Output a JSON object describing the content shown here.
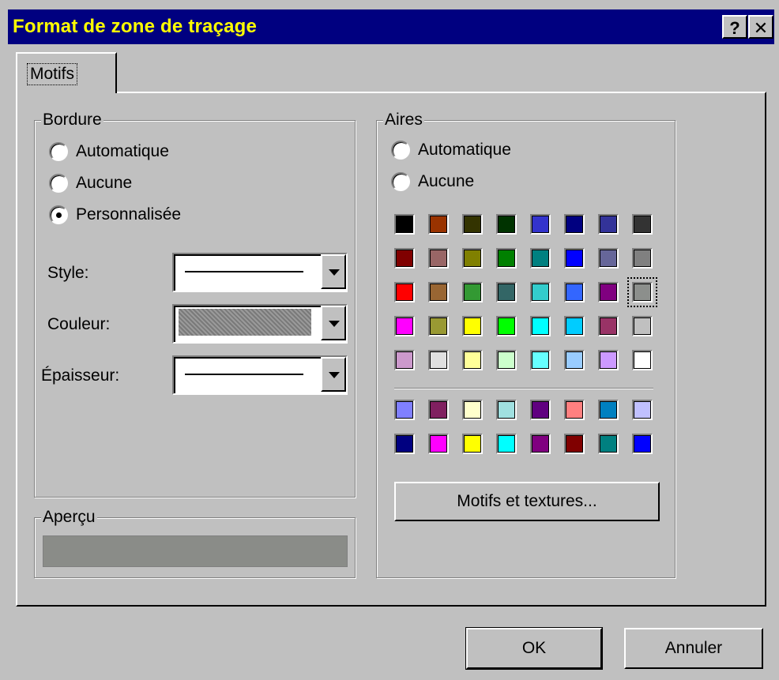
{
  "window": {
    "title": "Format de zone de traçage",
    "help_label": "?",
    "close_label": "✕"
  },
  "tabs": [
    {
      "label": "Motifs",
      "active": true
    }
  ],
  "border_group": {
    "label": "Bordure",
    "options": [
      {
        "label": "Automatique",
        "selected": false
      },
      {
        "label": "Aucune",
        "selected": false
      },
      {
        "label": "Personnalisée",
        "selected": true
      }
    ],
    "style_label": "Style:",
    "color_label": "Couleur:",
    "thickness_label": "Épaisseur:",
    "style_value": "solid-line",
    "color_value": "#8a8a8a",
    "thickness_value": "thin-line"
  },
  "preview_group": {
    "label": "Aperçu",
    "fill_color": "#8a8c88"
  },
  "area_group": {
    "label": "Aires",
    "options": [
      {
        "label": "Automatique",
        "selected": false
      },
      {
        "label": "Aucune",
        "selected": false
      }
    ],
    "palette_main": [
      [
        "#000000",
        "#993300",
        "#333300",
        "#003300",
        "#3333cc",
        "#000080",
        "#333399",
        "#333333"
      ],
      [
        "#800000",
        "#996666",
        "#808000",
        "#008000",
        "#008080",
        "#0000ff",
        "#666699",
        "#808080"
      ],
      [
        "#ff0000",
        "#996633",
        "#339933",
        "#336666",
        "#33cccc",
        "#3366ff",
        "#800080",
        "#8c8f8c"
      ],
      [
        "#ff00ff",
        "#999933",
        "#ffff00",
        "#00ff00",
        "#00ffff",
        "#00ccff",
        "#993366",
        "#c0c0c0"
      ],
      [
        "#cc99cc",
        "#e0e0e0",
        "#ffff99",
        "#ccffcc",
        "#66ffff",
        "#99ccff",
        "#cc99ff",
        "#ffffff"
      ]
    ],
    "palette_chart": [
      [
        "#8080ff",
        "#802060",
        "#ffffcc",
        "#a0e0e0",
        "#600080",
        "#ff8080",
        "#0080c0",
        "#c0c0ff"
      ],
      [
        "#000080",
        "#ff00ff",
        "#ffff00",
        "#00ffff",
        "#800080",
        "#800000",
        "#008080",
        "#0000ff"
      ]
    ],
    "selected_color": "#8c8f8c",
    "fill_effects_label": "Motifs et textures..."
  },
  "buttons": {
    "ok": "OK",
    "cancel": "Annuler"
  }
}
